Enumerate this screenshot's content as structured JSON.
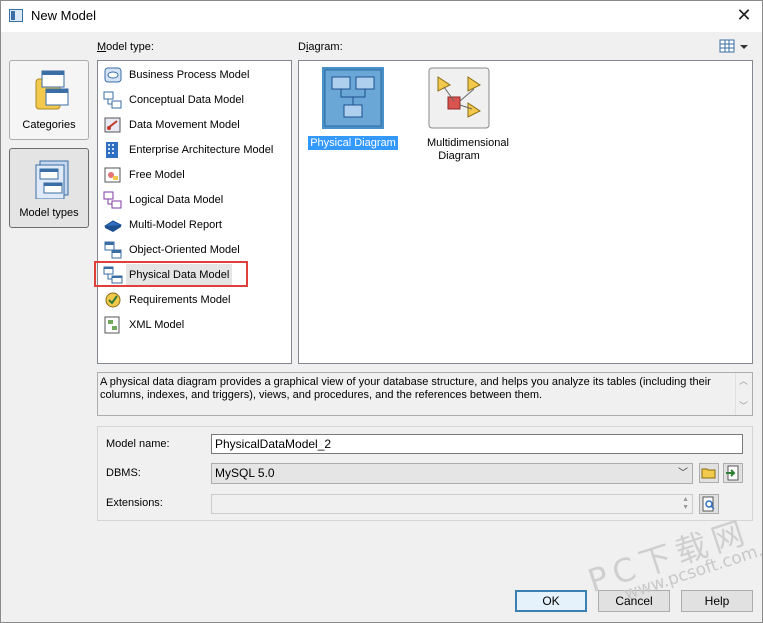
{
  "window": {
    "title": "New Model",
    "close_glyph": "✕"
  },
  "sidebar": {
    "items": [
      {
        "label": "Categories",
        "icon": "categories-icon"
      },
      {
        "label": "Model types",
        "icon": "model-types-icon"
      }
    ]
  },
  "model_type": {
    "label_prefix": "",
    "label_accel": "M",
    "label_rest": "odel type:",
    "items": [
      {
        "label": "Business Process Model",
        "icon": "business-process-icon"
      },
      {
        "label": "Conceptual Data Model",
        "icon": "conceptual-data-icon"
      },
      {
        "label": "Data Movement Model",
        "icon": "data-movement-icon"
      },
      {
        "label": "Enterprise Architecture Model",
        "icon": "enterprise-architecture-icon"
      },
      {
        "label": "Free Model",
        "icon": "free-model-icon"
      },
      {
        "label": "Logical Data Model",
        "icon": "logical-data-icon"
      },
      {
        "label": "Multi-Model Report",
        "icon": "multi-model-report-icon"
      },
      {
        "label": "Object-Oriented Model",
        "icon": "object-oriented-icon"
      },
      {
        "label": "Physical Data Model",
        "icon": "physical-data-icon",
        "selected": true
      },
      {
        "label": "Requirements Model",
        "icon": "requirements-icon"
      },
      {
        "label": "XML Model",
        "icon": "xml-model-icon"
      }
    ]
  },
  "diagram": {
    "label_prefix": "D",
    "label_accel": "i",
    "label_rest": "agram:",
    "items": [
      {
        "label": "Physical Diagram",
        "selected": true
      },
      {
        "label": "Multidimensional Diagram"
      }
    ]
  },
  "description": "A physical data diagram provides a graphical view of your database structure, and helps you analyze its tables (including their columns, indexes, and triggers), views, and procedures, and the references between them.",
  "properties": {
    "model_name_label": "Model name:",
    "model_name_value": "PhysicalDataModel_2",
    "dbms_label": "DBMS:",
    "dbms_value": "MySQL 5.0",
    "extensions_label": "Extensions:"
  },
  "buttons": {
    "ok": "OK",
    "cancel": "Cancel",
    "help": "Help"
  },
  "watermark": {
    "big": "PC下载网",
    "small": "www.pcsoft.com.cn"
  },
  "colors": {
    "selection": "#3399ff",
    "highlight_border": "#e0403a",
    "default_button_border": "#3c7fb1"
  }
}
